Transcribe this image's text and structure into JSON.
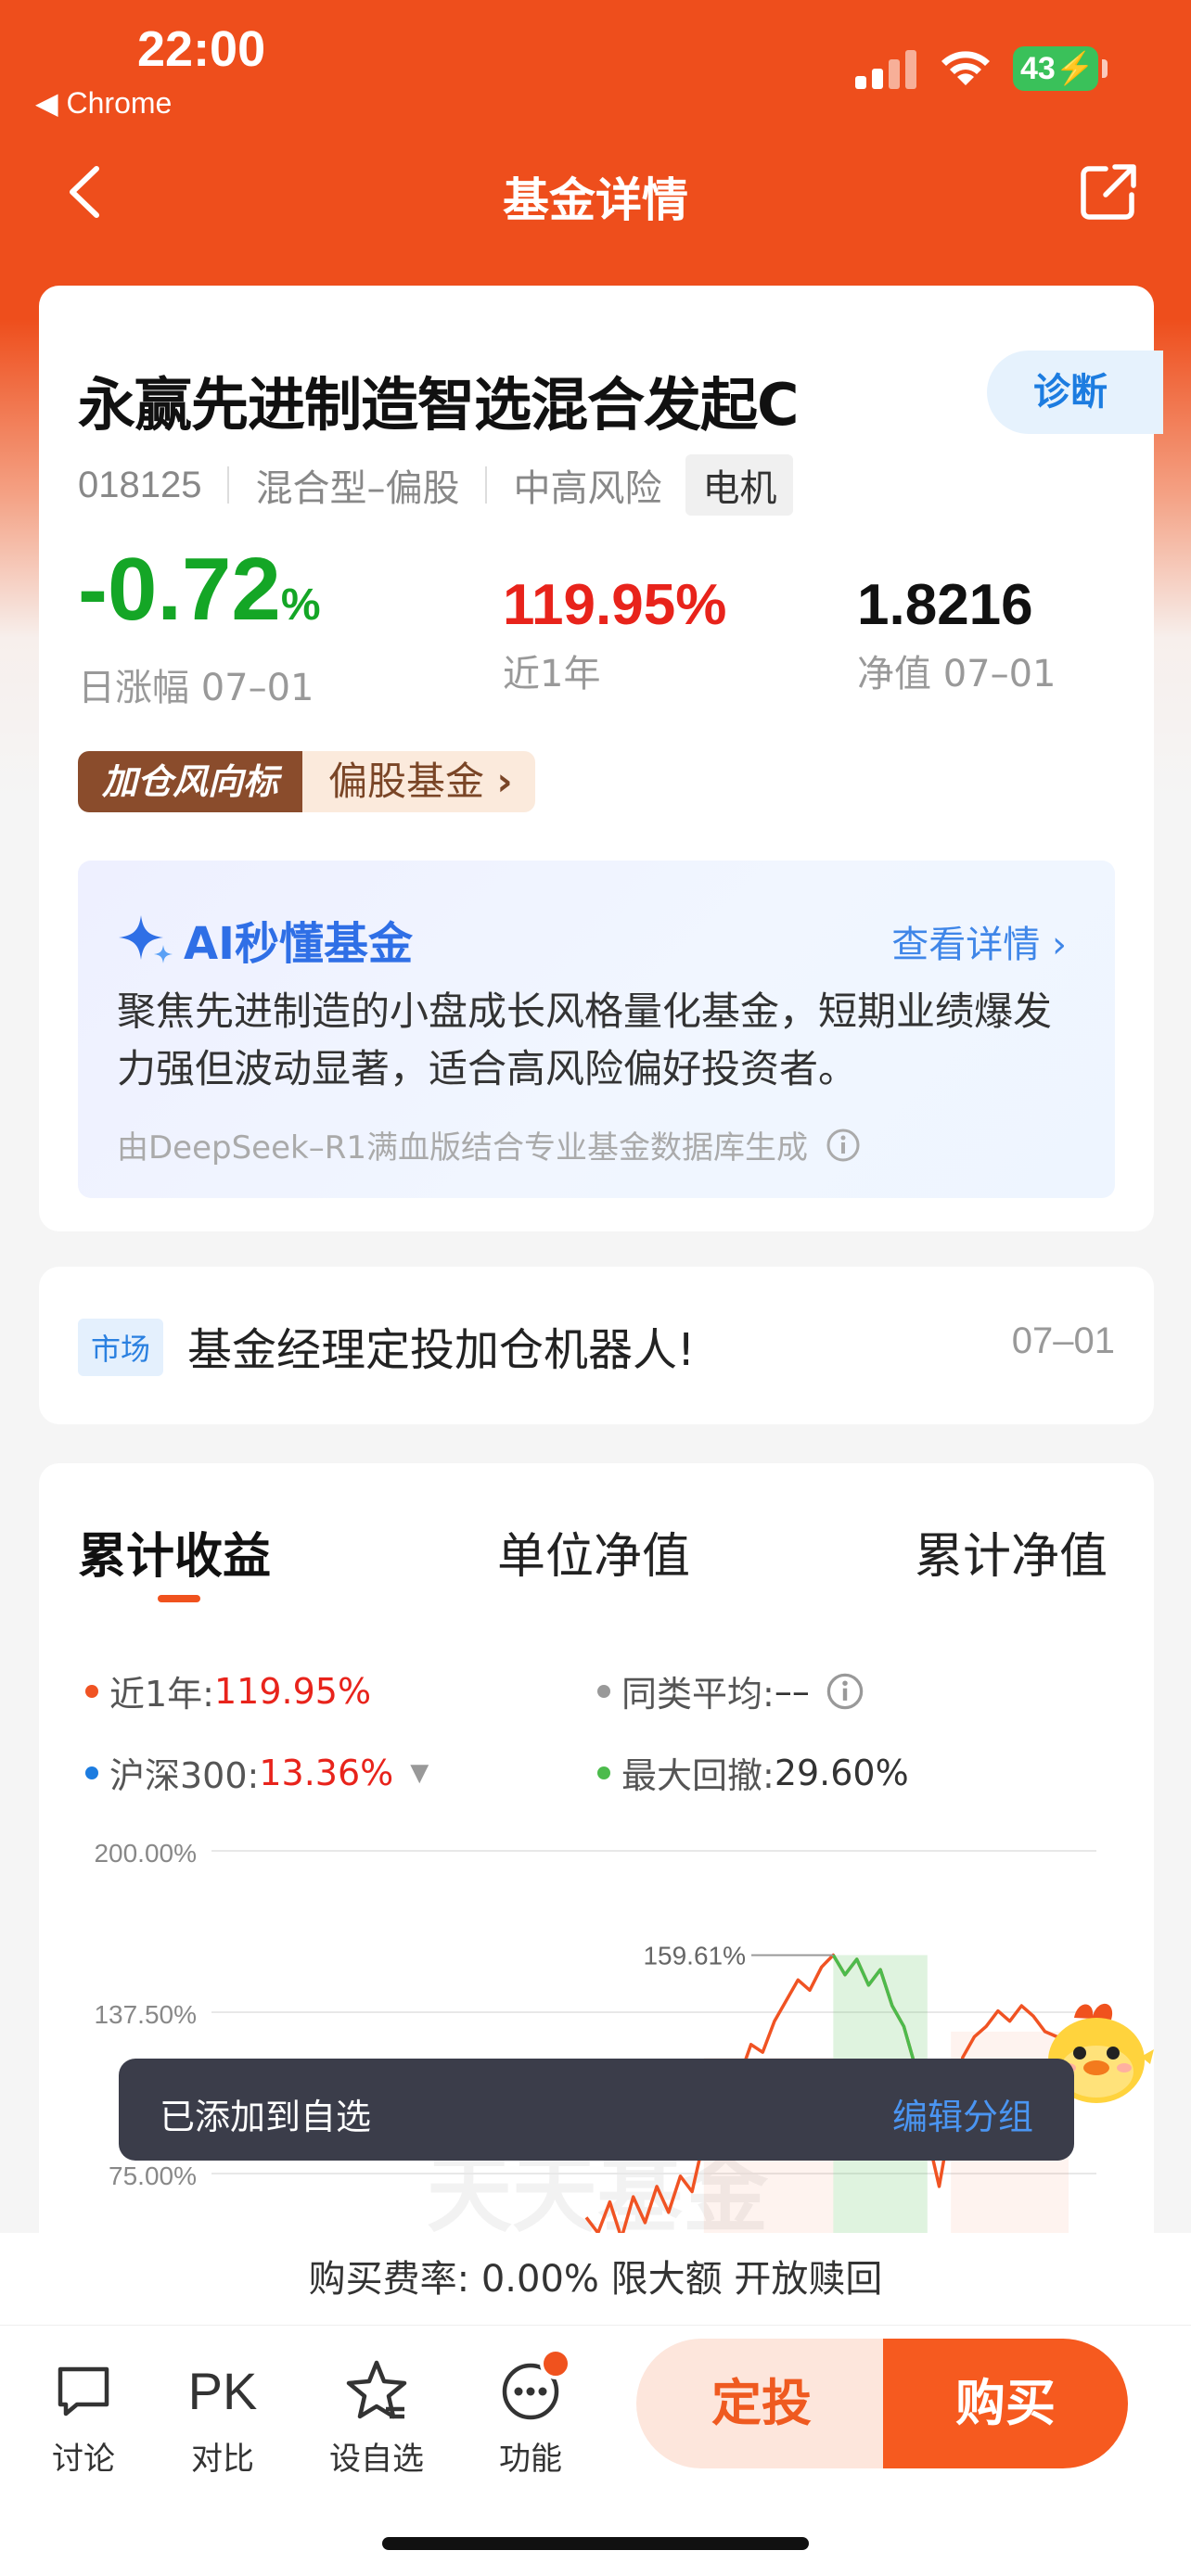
{
  "status_bar": {
    "time": "22:00",
    "back_app": "◀ Chrome",
    "battery": "43"
  },
  "nav": {
    "title": "基金详情"
  },
  "fund": {
    "name": "永赢先进制造智选混合发起C",
    "diagnose_label": "诊断",
    "code": "018125",
    "type": "混合型–偏股",
    "risk": "中高风险",
    "tag": "电机",
    "daily_change_value": "-0.72",
    "daily_change_unit": "%",
    "daily_change_label": "日涨幅 07–01",
    "year_return": "119.95%",
    "year_return_label": "近1年",
    "nav_value": "1.8216",
    "nav_label": "净值 07–01",
    "wind_label": "加仓风向标",
    "wind_link": "偏股基金"
  },
  "ai_summary": {
    "title": "AI秒懂基金",
    "detail_link": "查看详情",
    "text": "聚焦先进制造的小盘成长风格量化基金，短期业绩爆发力强但波动显著，适合高风险偏好投资者。",
    "generated_by": "由DeepSeek–R1满血版结合专业基金数据库生成"
  },
  "news": {
    "tag": "市场",
    "text": "基金经理定投加仓机器人!",
    "date": "07–01"
  },
  "chart_tabs": [
    "累计收益",
    "单位净值",
    "累计净值"
  ],
  "legend": {
    "year_label": "近1年:",
    "year_value": "119.95%",
    "peer_label": "同类平均:",
    "peer_value": "––",
    "hs300_label": "沪深300:",
    "hs300_value": "13.36%",
    "drawdown_label": "最大回撤:",
    "drawdown_value": "29.60%"
  },
  "colors": {
    "brand": "#ee4e1c",
    "up": "#e8231b",
    "down": "#14a626",
    "link": "#2f6fe6",
    "series_fund": "#f05323",
    "series_hs300": "#1c7ce0",
    "series_peer": "#999999",
    "series_drawdown": "#4cbb4c"
  },
  "chart_data": {
    "type": "line",
    "ylim": [
      75,
      200
    ],
    "y_ticks": [
      "200.00%",
      "137.50%",
      "75.00%"
    ],
    "y_tick_values": [
      200,
      137.5,
      75
    ],
    "peak_label": "159.61%",
    "peak_value": 159.61,
    "watermark": "天天基金",
    "series": [
      {
        "name": "近1年",
        "values": [
          58,
          52,
          64,
          50,
          66,
          56,
          70,
          60,
          74,
          68,
          88,
          95,
          104,
          112,
          125,
          122,
          134,
          142,
          150,
          146,
          155,
          159.61,
          152,
          158,
          148,
          154,
          140,
          132,
          116,
          90,
          70,
          96,
          120,
          128,
          132,
          138,
          134,
          140,
          136,
          130,
          128,
          124
        ]
      }
    ]
  },
  "toast": {
    "message": "已添加到自选",
    "action": "编辑分组"
  },
  "fee_bar": {
    "text": "购买费率: 0.00% 限大额 开放赎回"
  },
  "bottom_bar": {
    "discuss": "讨论",
    "compare_icon": "PK",
    "compare": "对比",
    "watchlist": "设自选",
    "functions": "功能",
    "sip": "定投",
    "buy": "购买"
  }
}
